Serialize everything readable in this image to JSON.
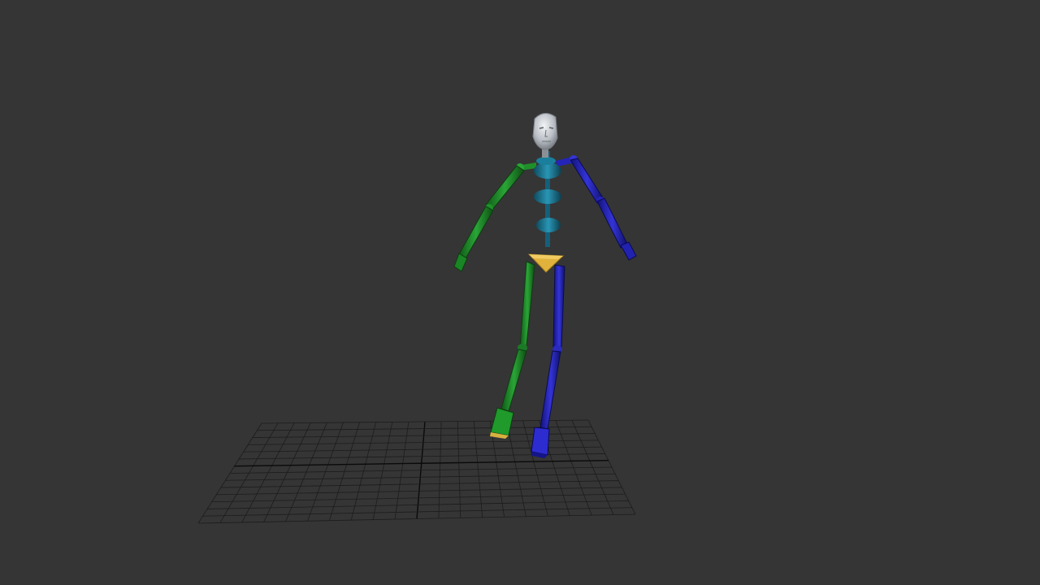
{
  "viewport": {
    "background_color": "#353535",
    "grid": {
      "visible": true,
      "line_color": "#1c1c1c",
      "center_line_color": "#0a0a0a"
    },
    "figure": {
      "type": "biped-skeleton",
      "colors": {
        "head": "#c8ccd2",
        "spine": "#1e7f9c",
        "pelvis": "#e0b23c",
        "left_side": "#1f8f2a",
        "right_side": "#2424b8"
      }
    }
  }
}
